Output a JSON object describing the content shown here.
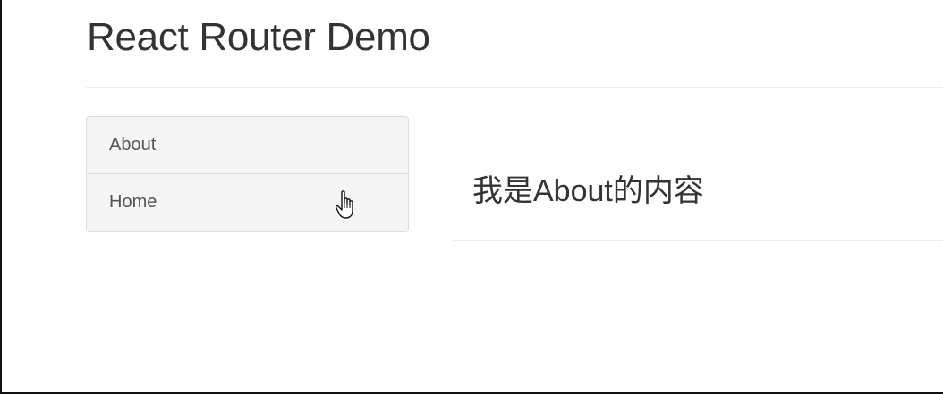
{
  "header": {
    "title": "React Router Demo"
  },
  "nav": {
    "items": [
      {
        "label": "About"
      },
      {
        "label": "Home"
      }
    ]
  },
  "content": {
    "text": "我是About的内容"
  },
  "colors": {
    "text": "#333333",
    "nav_text": "#555555",
    "nav_background": "#f5f5f5",
    "border": "#dddddd"
  },
  "cursor": {
    "icon": "hand-pointer-icon"
  }
}
